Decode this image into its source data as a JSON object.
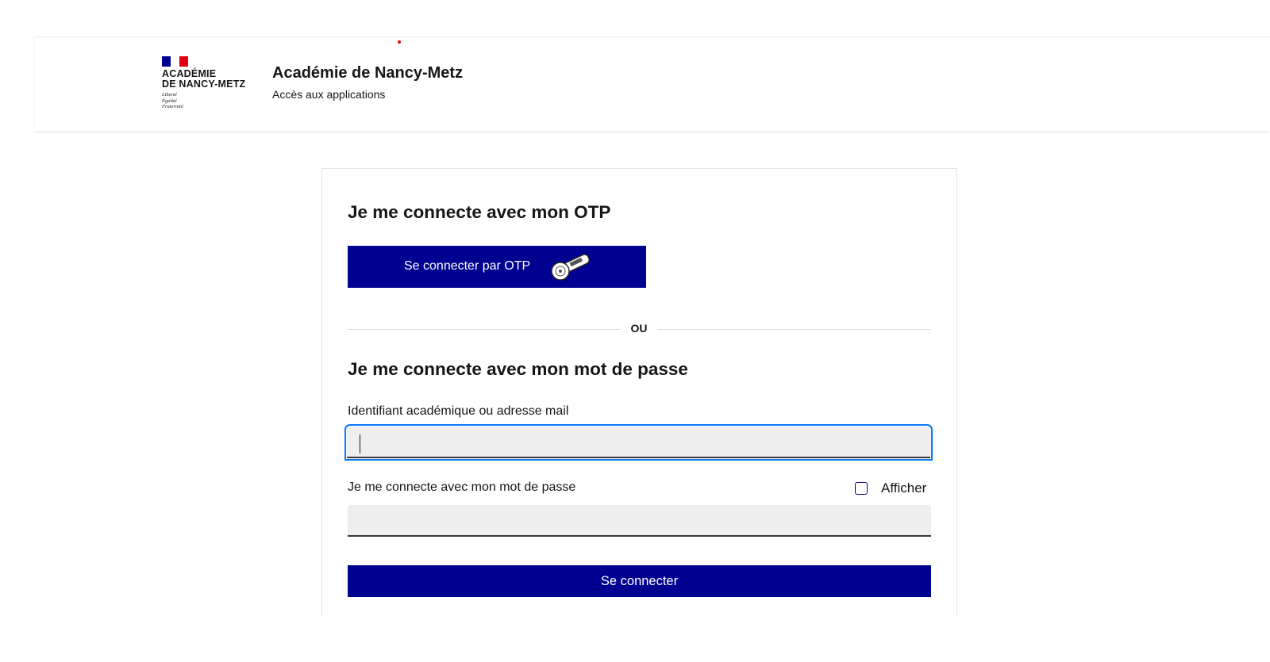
{
  "header": {
    "logo": {
      "title_line1": "ACADÉMIE",
      "title_line2": "DE NANCY-METZ",
      "motto_line1": "Liberté",
      "motto_line2": "Égalité",
      "motto_line3": "Fraternité",
      "flag_colors": [
        "#000091",
        "#ffffff",
        "#e1000f"
      ]
    },
    "site_title": "Académie de Nancy-Metz",
    "site_subtitle": "Accès aux applications"
  },
  "otp_section": {
    "heading": "Je me connecte avec mon OTP",
    "button_label": "Se connecter par OTP",
    "icon": "otp-key-icon"
  },
  "separator": {
    "text": "OU"
  },
  "password_section": {
    "heading": "Je me connecte avec mon mot de passe",
    "identifier_label": "Identifiant académique ou adresse mail",
    "identifier_value": "",
    "password_label": "Je me connecte avec mon mot de passe",
    "password_value": "",
    "show_password_label": "Afficher",
    "show_password_checked": false,
    "submit_label": "Se connecter"
  },
  "colors": {
    "primary": "#000091",
    "focus": "#0a76f6",
    "input_bg": "#eeeeee",
    "red": "#e1000f"
  }
}
